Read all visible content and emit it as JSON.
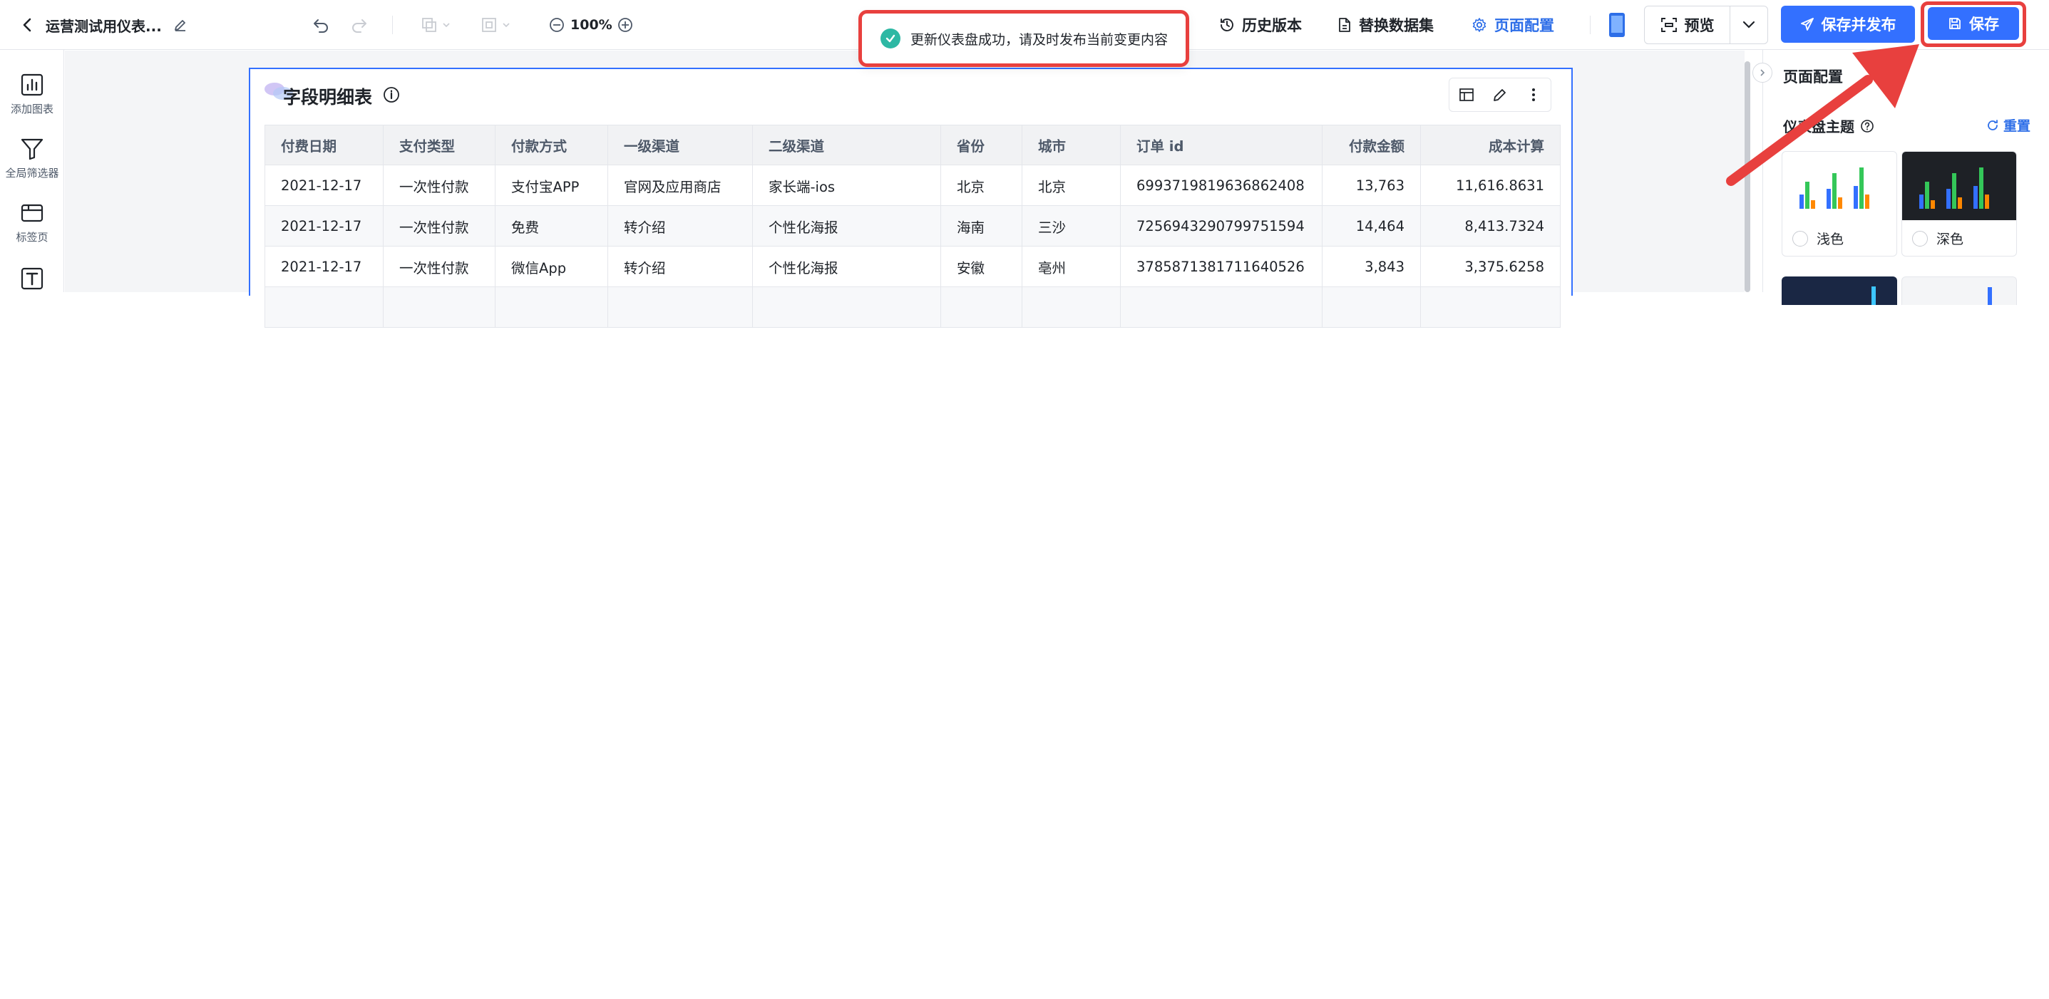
{
  "header": {
    "title": "运营测试用仪表...",
    "zoom": "100%",
    "toast": "更新仪表盘成功，请及时发布当前变更内容",
    "history": "历史版本",
    "replace_dataset": "替换数据集",
    "page_config": "页面配置",
    "preview": "预览",
    "save_publish": "保存并发布",
    "save": "保存"
  },
  "rail": {
    "items": [
      {
        "label": "添加图表",
        "icon": "bar-chart-icon"
      },
      {
        "label": "全局筛选器",
        "icon": "filter-icon"
      },
      {
        "label": "标签页",
        "icon": "tab-icon"
      },
      {
        "label": "",
        "icon": "text-icon"
      }
    ]
  },
  "card": {
    "title": "字段明细表",
    "columns": [
      "付费日期",
      "支付类型",
      "付款方式",
      "一级渠道",
      "二级渠道",
      "省份",
      "城市",
      "订单 id",
      "付款金额",
      "成本计算"
    ],
    "rows": [
      [
        "2021-12-17",
        "一次性付款",
        "支付宝APP",
        "官网及应用商店",
        "家长端-ios",
        "北京",
        "北京",
        "6993719819636862408",
        "13,763",
        "11,616.8631"
      ],
      [
        "2021-12-17",
        "一次性付款",
        "免费",
        "转介绍",
        "个性化海报",
        "海南",
        "三沙",
        "7256943290799751594",
        "14,464",
        "8,413.7324"
      ],
      [
        "2021-12-17",
        "一次性付款",
        "微信App",
        "转介绍",
        "个性化海报",
        "安徽",
        "亳州",
        "3785871381711640526",
        "3,843",
        "3,375.6258"
      ]
    ]
  },
  "panel": {
    "title": "页面配置",
    "theme_label": "仪表盘主题",
    "reset": "重置",
    "themes": [
      {
        "label": "浅色"
      },
      {
        "label": "深色"
      }
    ]
  },
  "colors": {
    "accent": "#3370ff",
    "highlight": "#e8403e",
    "success": "#2eb8a4"
  }
}
